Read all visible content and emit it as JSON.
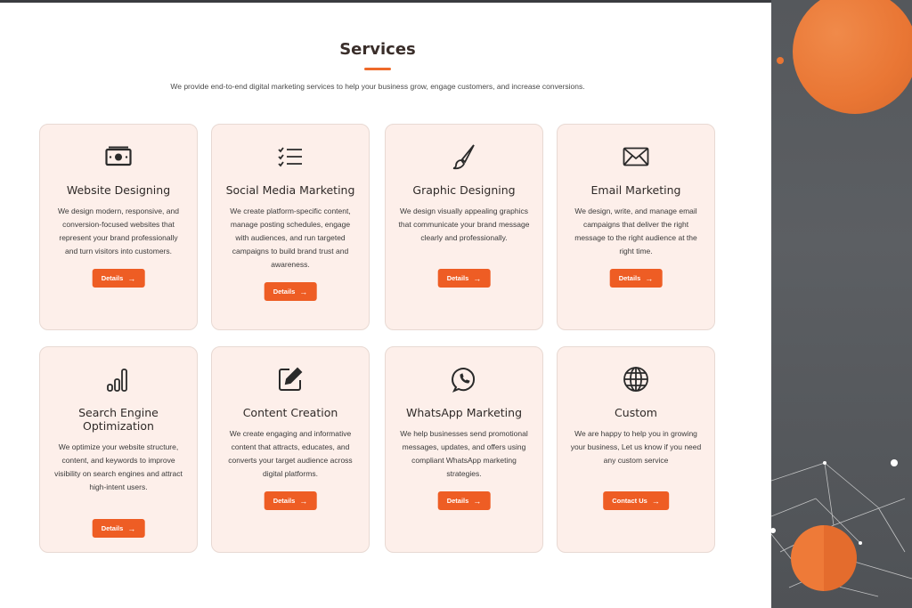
{
  "header": {
    "title": "Services",
    "subtitle": "We provide end-to-end digital marketing services to help your business grow, engage customers, and increase conversions."
  },
  "colors": {
    "accent": "#ee5d24",
    "card_bg": "#fdefea",
    "title": "#3a2e2a"
  },
  "services": [
    {
      "title": "Website Designing",
      "icon": "money-bill-icon",
      "description": "We design modern, responsive, and conversion-focused websites that represent your brand professionally and turn visitors into customers.",
      "button": "Details"
    },
    {
      "title": "Social Media Marketing",
      "icon": "checklist-icon",
      "description": "We create platform-specific content, manage posting schedules, engage with audiences, and run targeted campaigns to build brand trust and awareness.",
      "button": "Details"
    },
    {
      "title": "Graphic Designing",
      "icon": "paint-brush-icon",
      "description": "We design visually appealing graphics that communicate your brand message clearly and professionally.",
      "button": "Details"
    },
    {
      "title": "Email Marketing",
      "icon": "envelope-icon",
      "description": "We design, write, and manage email campaigns that deliver the right message to the right audience at the right time.",
      "button": "Details"
    },
    {
      "title": "Search Engine Optimization",
      "icon": "bar-chart-icon",
      "description": "We optimize your website structure, content, and keywords to improve visibility on search engines and attract high-intent users.",
      "button": "Details"
    },
    {
      "title": "Content Creation",
      "icon": "edit-icon",
      "description": "We create engaging and informative content that attracts, educates, and converts your target audience across digital platforms.",
      "button": "Details"
    },
    {
      "title": "WhatsApp Marketing",
      "icon": "whatsapp-icon",
      "description": "We help businesses send promotional messages, updates, and offers using compliant WhatsApp marketing strategies.",
      "button": "Details"
    },
    {
      "title": "Custom",
      "icon": "globe-icon",
      "description": "We are happy to help you in growing your business, Let us know if you need any custom service",
      "button": "Contact Us"
    }
  ]
}
